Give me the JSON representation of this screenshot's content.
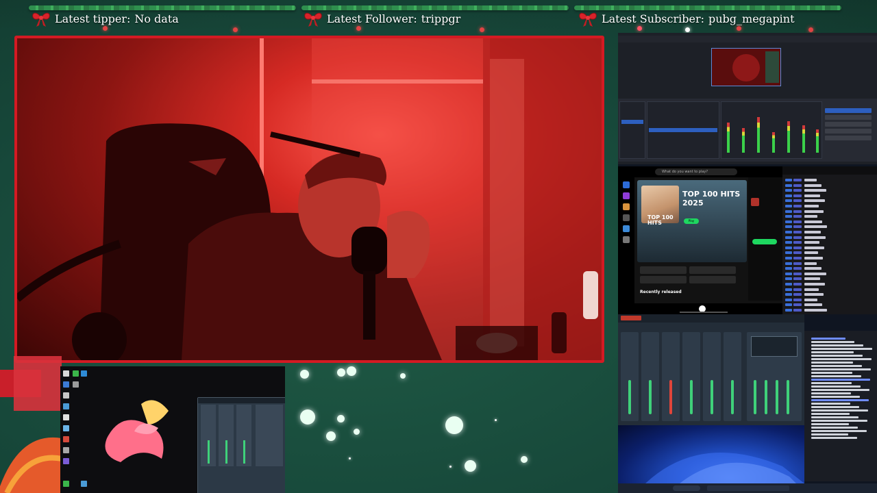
{
  "overlay": {
    "tipper": {
      "label": "Latest tipper:",
      "value": "No data"
    },
    "follower": {
      "label": "Latest Follower:",
      "value": "trippgr"
    },
    "subscriber": {
      "label": "Latest Subscriber:",
      "value": "pubg_megapint"
    }
  },
  "spotify": {
    "search_placeholder": "What do you want to play?",
    "cover_text": "TOP 100 HITS",
    "playlist_title": "TOP 100 HITS 2025",
    "play_label": "Play",
    "recent_label": "Recently released"
  },
  "colors": {
    "accent_red": "#d41a23",
    "background_green": "#17483a",
    "text": "#ffffff"
  }
}
